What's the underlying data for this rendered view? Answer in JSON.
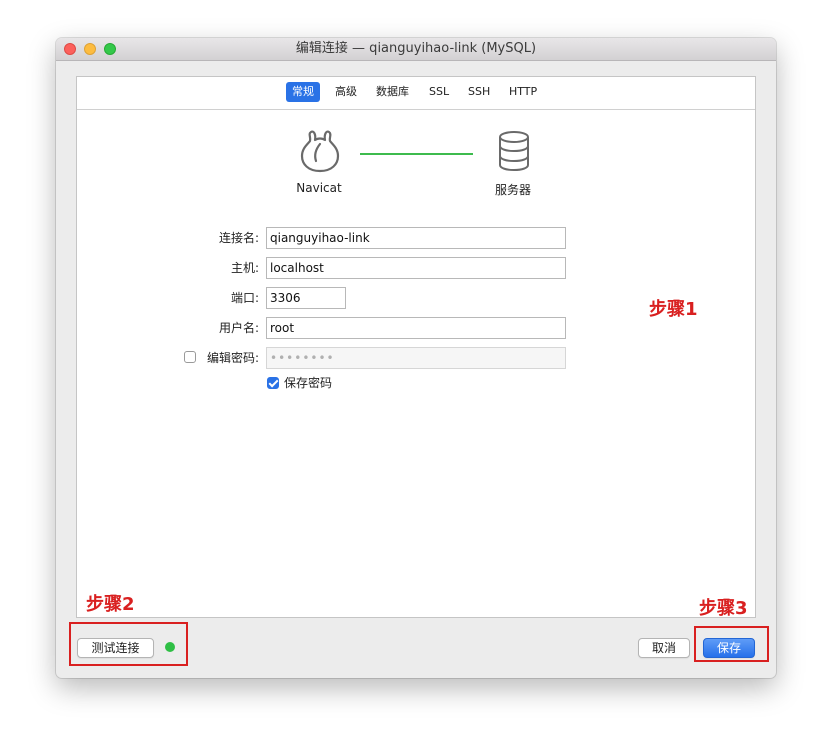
{
  "window": {
    "title": "编辑连接 — qianguyihao-link (MySQL)"
  },
  "tabs": [
    {
      "label": "常规",
      "active": true
    },
    {
      "label": "高级",
      "active": false
    },
    {
      "label": "数据库",
      "active": false
    },
    {
      "label": "SSL",
      "active": false
    },
    {
      "label": "SSH",
      "active": false
    },
    {
      "label": "HTTP",
      "active": false
    }
  ],
  "diagram": {
    "left_label": "Navicat",
    "right_label": "服务器",
    "left_icon": "navicat-logo-icon",
    "right_icon": "database-server-icon"
  },
  "form": {
    "connection_name": {
      "label": "连接名:",
      "value": "qianguyihao-link"
    },
    "host": {
      "label": "主机:",
      "value": "localhost"
    },
    "port": {
      "label": "端口:",
      "value": "3306"
    },
    "username": {
      "label": "用户名:",
      "value": "root"
    },
    "edit_password": {
      "label": "编辑密码:",
      "checked": false,
      "value": "••••••••"
    },
    "save_password": {
      "label": "保存密码",
      "checked": true
    }
  },
  "buttons": {
    "test_connection": "测试连接",
    "cancel": "取消",
    "save": "保存"
  },
  "annotations": {
    "step1": "步骤1",
    "step2": "步骤2",
    "step3": "步骤3"
  },
  "colors": {
    "accent": "#2a72e6",
    "connection_line": "#3dbb4e",
    "status_ok": "#2fbf45",
    "annotation": "#d92020"
  }
}
